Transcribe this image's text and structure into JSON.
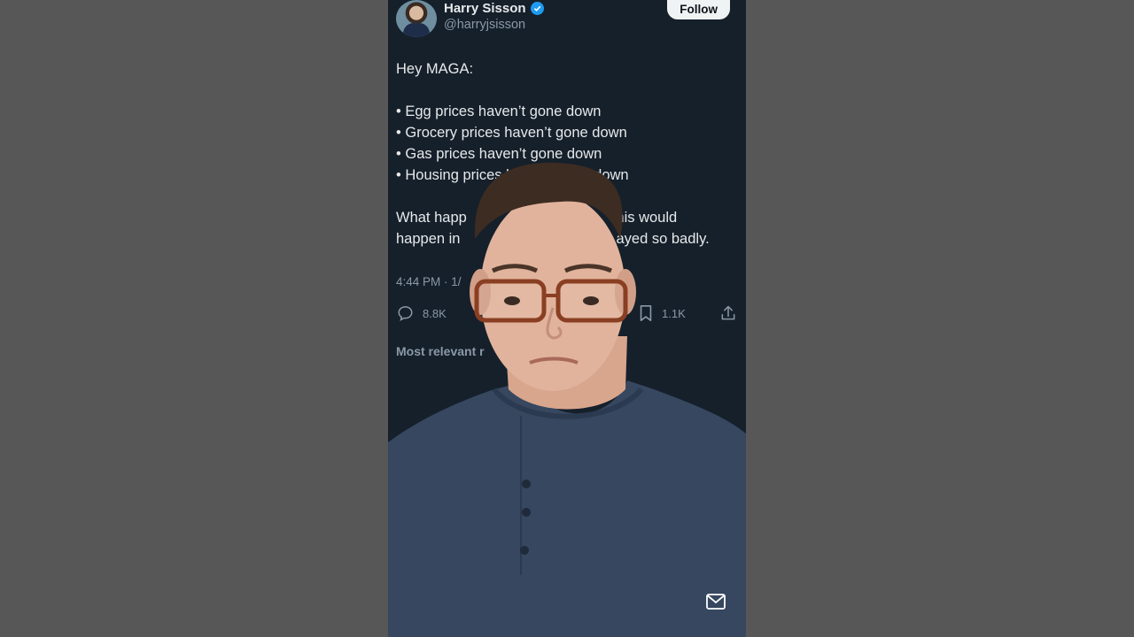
{
  "colors": {
    "page_background": "#575757",
    "app_background": "#15202b",
    "text_primary": "#e7e9ea",
    "text_secondary": "#8b98a5",
    "verified_badge": "#1d9bf0",
    "follow_button": "#eff3f4",
    "shirt": "#36475f"
  },
  "author": {
    "display_name": "Harry Sisson",
    "handle": "@harryjsisson",
    "verified": true,
    "follow_label": "Follow"
  },
  "tweet": {
    "greeting": "Hey MAGA:",
    "bullets": [
      "• Egg prices haven’t gone down",
      "• Grocery prices haven’t gone down",
      "• Gas prices haven’t gone down",
      "• Housing prices haven’t gone down"
    ],
    "closing_line_1": "What happ",
    "closing_line_1_end": "this would",
    "closing_line_2": "happen in",
    "closing_line_2_end": "ayed so badly.",
    "timestamp": "4:44 PM · 1/"
  },
  "actions": {
    "replies": "8.8K",
    "bookmarks": "1.1K"
  },
  "replies_sort": "Most relevant r",
  "icons": {
    "reply": "reply-icon",
    "bookmark": "bookmark-icon",
    "share": "share-icon",
    "mail": "mail-icon",
    "verified": "verified-badge-icon"
  }
}
